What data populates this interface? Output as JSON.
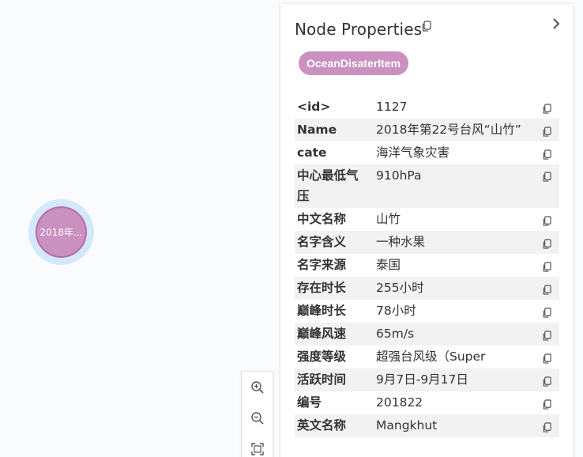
{
  "graph": {
    "node_label": "2018年..."
  },
  "panel": {
    "title": "Node Properties",
    "label_chip": "OceanDisaterItem",
    "properties": [
      {
        "key": "<id>",
        "value": "1127"
      },
      {
        "key": "Name",
        "value": "2018年第22号台风“山竹”"
      },
      {
        "key": "cate",
        "value": "海洋气象灾害"
      },
      {
        "key": "中心最低气压",
        "value": "910hPa"
      },
      {
        "key": "中文名称",
        "value": "山竹"
      },
      {
        "key": "名字含义",
        "value": "一种水果"
      },
      {
        "key": "名字来源",
        "value": "泰国"
      },
      {
        "key": "存在时长",
        "value": "255小时"
      },
      {
        "key": "巅峰时长",
        "value": "78小时"
      },
      {
        "key": "巅峰风速",
        "value": "65m/s"
      },
      {
        "key": "强度等级",
        "value": "超强台风级（Super"
      },
      {
        "key": "活跃时间",
        "value": "9月7日-9月17日"
      },
      {
        "key": "编号",
        "value": "201822"
      },
      {
        "key": "英文名称",
        "value": "Mangkhut"
      }
    ]
  },
  "icons": {
    "copy": "copy-icon",
    "collapse": "chevron-right-icon",
    "zoom_in": "zoom-in-icon",
    "zoom_out": "zoom-out-icon",
    "fit": "fit-screen-icon"
  },
  "colors": {
    "node_fill": "#c990c0",
    "node_halo": "#d3e9fb",
    "chip": "#c990c0",
    "alt_row": "#f2f2f2"
  }
}
